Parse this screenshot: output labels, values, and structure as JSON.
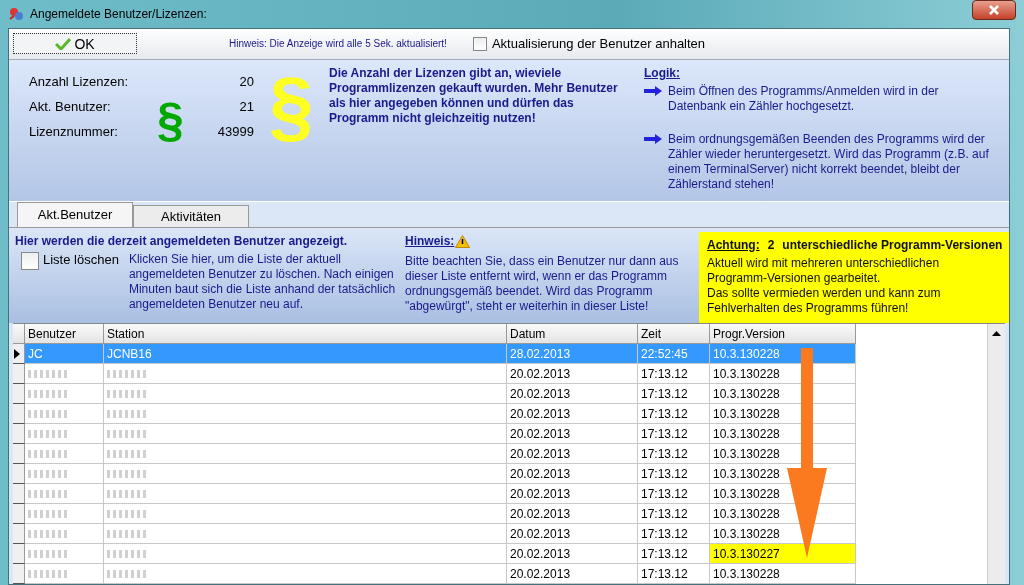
{
  "window": {
    "title": "Angemeldete Benutzer/Lizenzen:"
  },
  "toolbar": {
    "ok_button": "OK",
    "hint": "Hinweis: Die Anzeige wird alle 5 Sek. aktualisiert!",
    "pause_checkbox": {
      "label": "Aktualisierung der Benutzer anhalten",
      "checked": false
    }
  },
  "license_info": {
    "fields": [
      {
        "label": "Anzahl Lizenzen:",
        "value": "20"
      },
      {
        "label": "Akt. Benutzer:",
        "value": "21"
      },
      {
        "label": "Lizenznummer:",
        "value": "43999"
      }
    ],
    "small_mark": "§",
    "large_mark": "§",
    "text": "Die Anzahl der Lizenzen gibt an, wieviele Programmlizenzen gekauft wurden. Mehr Benutzer als hier angegeben können und dürfen das Programm nicht gleichzeitig nutzen!",
    "logic": {
      "title": "Logik:",
      "items": [
        "Beim Öffnen des Programms/Anmelden wird in der Datenbank ein Zähler hochgesetzt.",
        "Beim ordnungsgemäßen Beenden des Programms wird der Zähler wieder heruntergesetzt. Wird das Programm (z.B. auf einem TerminalServer) nicht korrekt beendet, bleibt der Zählerstand stehen!"
      ]
    }
  },
  "tabs": [
    {
      "label": "Akt.Benutzer",
      "selected": true
    },
    {
      "label": "Aktivitäten",
      "selected": false
    }
  ],
  "tab_content": {
    "heading": "Hier werden die derzeit angemeldeten Benutzer angezeigt.",
    "clear_checkbox": {
      "label": "Liste löschen",
      "checked": false
    },
    "clear_text": "Klicken Sie hier, um die Liste der aktuell angemeldeten Benutzer zu löschen.  Nach einigen Minuten baut sich die Liste anhand der tatsächlich angemeldeten Benutzer neu auf.",
    "hint": {
      "title": "Hinweis:",
      "text": "Bitte beachten Sie, dass ein Benutzer nur dann aus dieser Liste entfernt wird, wenn er das Programm ordnungsgemäß beendet. Wird das Programm \"abgewürgt\", steht er weiterhin in dieser Liste!"
    },
    "warning": {
      "label": "Achtung:",
      "count": "2",
      "title": "unterschiedliche Programm-Versionen",
      "lines": [
        "Aktuell wird mit mehreren unterschiedlichen Programm-Versionen gearbeitet.",
        "Das sollte vermieden werden und kann zum Fehlverhalten des Programms führen!"
      ]
    }
  },
  "table": {
    "columns": [
      "Benutzer",
      "Station",
      "Datum",
      "Zeit",
      "Progr.Version"
    ],
    "rows": [
      {
        "user": "JC",
        "station": "JCNB16",
        "date": "28.02.2013",
        "time": "22:52:45",
        "version": "10.3.130228",
        "selected": true,
        "redacted": false,
        "highlighted": false
      },
      {
        "date": "20.02.2013",
        "time": "17:13.12",
        "version": "10.3.130228",
        "selected": false,
        "redacted": true,
        "highlighted": false
      },
      {
        "date": "20.02.2013",
        "time": "17:13.12",
        "version": "10.3.130228",
        "selected": false,
        "redacted": true,
        "highlighted": false
      },
      {
        "date": "20.02.2013",
        "time": "17:13.12",
        "version": "10.3.130228",
        "selected": false,
        "redacted": true,
        "highlighted": false
      },
      {
        "date": "20.02.2013",
        "time": "17:13.12",
        "version": "10.3.130228",
        "selected": false,
        "redacted": true,
        "highlighted": false
      },
      {
        "date": "20.02.2013",
        "time": "17:13.12",
        "version": "10.3.130228",
        "selected": false,
        "redacted": true,
        "highlighted": false
      },
      {
        "date": "20.02.2013",
        "time": "17:13.12",
        "version": "10.3.130228",
        "selected": false,
        "redacted": true,
        "highlighted": false
      },
      {
        "date": "20.02.2013",
        "time": "17:13.12",
        "version": "10.3.130228",
        "selected": false,
        "redacted": true,
        "highlighted": false
      },
      {
        "date": "20.02.2013",
        "time": "17:13.12",
        "version": "10.3.130228",
        "selected": false,
        "redacted": true,
        "highlighted": false
      },
      {
        "date": "20.02.2013",
        "time": "17:13.12",
        "version": "10.3.130228",
        "selected": false,
        "redacted": true,
        "highlighted": false
      },
      {
        "date": "20.02.2013",
        "time": "17:13.12",
        "version": "10.3.130227",
        "selected": false,
        "redacted": true,
        "highlighted": true
      },
      {
        "date": "20.02.2013",
        "time": "17:13.12",
        "version": "10.3.130228",
        "selected": false,
        "redacted": true,
        "highlighted": false
      }
    ]
  }
}
